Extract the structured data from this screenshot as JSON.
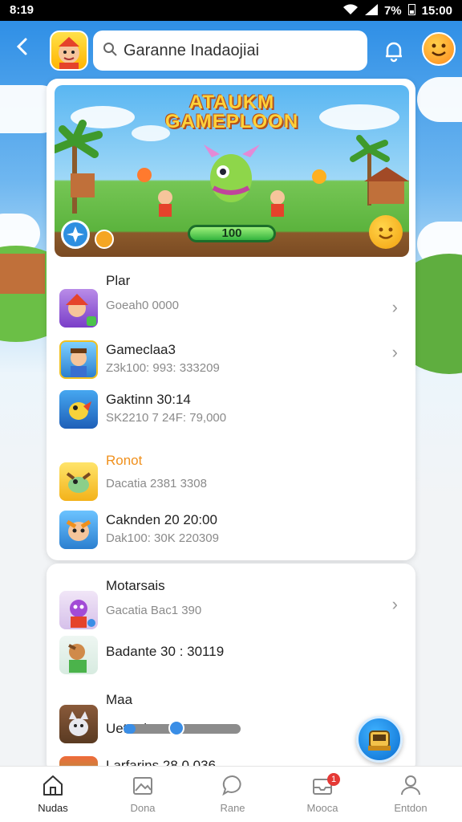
{
  "status": {
    "time": "8:19",
    "battery": "7%",
    "clock": "15:00"
  },
  "search": {
    "value": "Garanne Inadaojiai"
  },
  "banner": {
    "title": "ATAUKM\nGAMEPLOON",
    "score": "100"
  },
  "list1": [
    {
      "title": "Plar",
      "sub": "Goeah0 0000",
      "chevron": true
    },
    {
      "title": "Gameclaa3",
      "sub": "Z3k100: 993: 333209",
      "chevron": true
    },
    {
      "title": "Gaktinn 30:14",
      "sub": "SK2210 7 24F: 79,000",
      "chevron": false
    }
  ],
  "section_label_orange": "Ronot",
  "list2": [
    {
      "title": "",
      "sub": "Dacatia 2381 3308"
    },
    {
      "title": "Caknden 20 20:00",
      "sub": "Dak100: 30K 220309"
    }
  ],
  "card2": {
    "header": "Motarsais",
    "rows": [
      {
        "title": "",
        "sub": "Gacatia Bac1 390",
        "chevron": true
      },
      {
        "title": "Badante 30 : 30119",
        "sub": ""
      }
    ],
    "section_label": "Maa",
    "progress_row": {
      "title": "Uetardem",
      "progress": 0.1
    },
    "last_row": {
      "title": "Larfarins 28 0 036"
    }
  },
  "tabs": [
    {
      "label": "Nudas",
      "icon": "home-icon",
      "active": true
    },
    {
      "label": "Dona",
      "icon": "image-icon",
      "active": false
    },
    {
      "label": "Rane",
      "icon": "chat-icon",
      "active": false
    },
    {
      "label": "Mooca",
      "icon": "inbox-icon",
      "active": false,
      "badge": "1"
    },
    {
      "label": "Entdon",
      "icon": "person-icon",
      "active": false
    }
  ],
  "colors": {
    "accent": "#2f8fe6",
    "orange": "#f0901c",
    "badge": "#e53935"
  }
}
